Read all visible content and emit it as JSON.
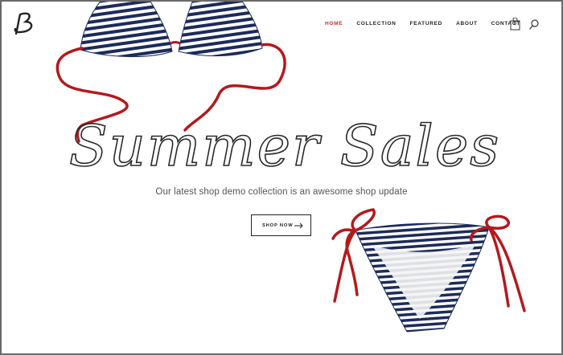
{
  "brand": {
    "logo_letter": "B",
    "logo_icon": "script-b-logo-icon"
  },
  "nav": {
    "items": [
      {
        "label": "HOME",
        "active": true
      },
      {
        "label": "COLLECTION",
        "active": false
      },
      {
        "label": "FEATURED",
        "active": false
      },
      {
        "label": "ABOUT",
        "active": false
      },
      {
        "label": "CONTACT",
        "active": false
      }
    ],
    "cart_count": "0",
    "cart_icon": "shopping-bag-icon",
    "search_icon": "search-icon"
  },
  "hero": {
    "headline": "Summer Sales",
    "subtitle": "Our latest shop demo collection is an awesome shop update",
    "cta_label": "SHOP NOW",
    "cta_icon": "arrow-right-icon"
  },
  "colors": {
    "accent": "#c8312b",
    "stripe_navy": "#1c2b5a",
    "string_red": "#b3191c",
    "text_dark": "#222222",
    "frame_gray": "#6a6a6a"
  }
}
